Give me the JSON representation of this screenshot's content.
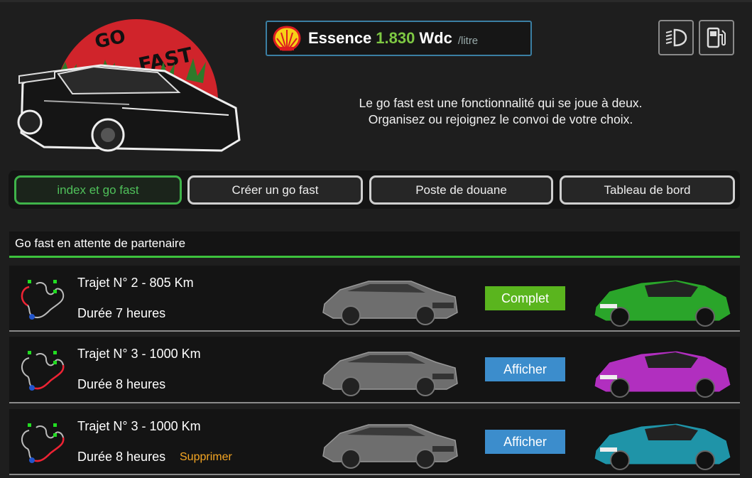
{
  "logo": {
    "line1": "GO",
    "line2": "FAST"
  },
  "fuel": {
    "label": "Essence",
    "price": "1.830",
    "currency": "Wdc",
    "unit": "/litre",
    "icon": "shell-icon"
  },
  "toolbar": {
    "headlight_icon": "headlight-icon",
    "fuel_icon": "fuel-pump-icon"
  },
  "intro": {
    "line1": "Le go fast est une fonctionnalité qui se joue à deux.",
    "line2": "Organisez ou rejoignez le convoi de votre choix."
  },
  "nav": [
    {
      "label": "index et go fast",
      "active": true
    },
    {
      "label": "Créer un go fast",
      "active": false
    },
    {
      "label": "Poste de douane",
      "active": false
    },
    {
      "label": "Tableau de bord",
      "active": false
    }
  ],
  "list": {
    "title": "Go fast en attente de partenaire",
    "rows": [
      {
        "title": "Trajet N° 2 - 805 Km",
        "duration": "Durée 7 heures",
        "action": "Complet",
        "delete": "",
        "car_color": "#2aa52a"
      },
      {
        "title": "Trajet N° 3 - 1000 Km",
        "duration": "Durée 8 heures",
        "action": "Afficher",
        "delete": "",
        "car_color": "#b12fbf"
      },
      {
        "title": "Trajet N° 3 - 1000 Km",
        "duration": "Durée 8 heures",
        "action": "Afficher",
        "delete": "Supprimer",
        "car_color": "#1f94a8"
      }
    ]
  },
  "colors": {
    "accent_green": "#3cc23c",
    "complete_btn": "#5ab51e",
    "view_btn": "#3c8dcc",
    "delete_link": "#f5a623",
    "price": "#7ec843"
  }
}
